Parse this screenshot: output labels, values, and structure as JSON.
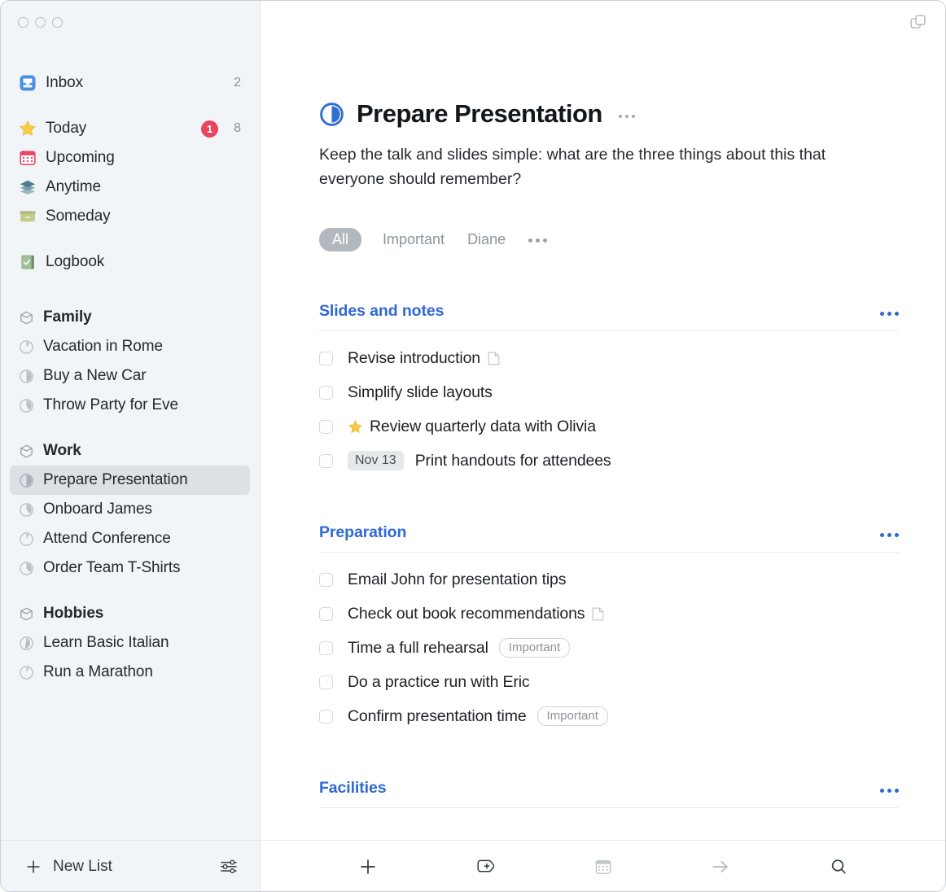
{
  "window": {
    "traffic_lights": [
      "close",
      "minimize",
      "zoom"
    ],
    "sidebar_toggle_icon": "split-view-icon",
    "accent_color": "#3069d3",
    "badge_color": "#e8455f"
  },
  "sidebar": {
    "top_items": [
      {
        "label": "Inbox",
        "icon": "inbox-icon",
        "count": "2",
        "badge": null,
        "bold": false
      },
      {
        "label": "Today",
        "icon": "star-icon",
        "count": "8",
        "badge": "1",
        "bold": false
      },
      {
        "label": "Upcoming",
        "icon": "calendar-icon",
        "count": "",
        "badge": null,
        "bold": false
      },
      {
        "label": "Anytime",
        "icon": "layers-icon",
        "count": "",
        "badge": null,
        "bold": false
      },
      {
        "label": "Someday",
        "icon": "box-icon",
        "count": "",
        "badge": null,
        "bold": false
      },
      {
        "label": "Logbook",
        "icon": "logbook-icon",
        "count": "",
        "badge": null,
        "bold": false
      }
    ],
    "areas": [
      {
        "label": "Family",
        "icon": "area-icon",
        "projects": [
          {
            "label": "Vacation in Rome",
            "icon": "project-progress-icon",
            "progress": 0.18
          },
          {
            "label": "Buy a New Car",
            "icon": "project-progress-icon",
            "progress": 0.5
          },
          {
            "label": "Throw Party for Eve",
            "icon": "project-progress-icon",
            "progress": 0.33
          }
        ]
      },
      {
        "label": "Work",
        "icon": "area-icon",
        "projects": [
          {
            "label": "Prepare Presentation",
            "icon": "project-progress-icon",
            "progress": 0.5,
            "selected": true
          },
          {
            "label": "Onboard James",
            "icon": "project-progress-icon",
            "progress": 0.3
          },
          {
            "label": "Attend Conference",
            "icon": "project-progress-icon",
            "progress": 0.15
          },
          {
            "label": "Order Team T-Shirts",
            "icon": "project-progress-icon",
            "progress": 0.28
          }
        ]
      },
      {
        "label": "Hobbies",
        "icon": "area-icon",
        "projects": [
          {
            "label": "Learn Basic Italian",
            "icon": "project-progress-icon",
            "progress": 0.55
          },
          {
            "label": "Run a Marathon",
            "icon": "project-progress-icon",
            "progress": 0.12
          }
        ]
      }
    ],
    "footer": {
      "new_list_label": "New List",
      "new_list_icon": "plus-icon",
      "settings_icon": "sliders-icon"
    }
  },
  "main": {
    "project": {
      "title": "Prepare Presentation",
      "icon": "project-progress-icon",
      "progress": 0.5,
      "more_icon": "ellipsis-icon",
      "notes": "Keep the talk and slides simple: what are the three things about this that everyone should remember?"
    },
    "filters": {
      "items": [
        "All",
        "Important",
        "Diane"
      ],
      "active": "All",
      "more_icon": "ellipsis-icon"
    },
    "sections": [
      {
        "title": "Slides and notes",
        "more_icon": "ellipsis-icon",
        "todos": [
          {
            "title": "Revise introduction",
            "checked": false,
            "star": false,
            "note": true,
            "date": null,
            "tags": []
          },
          {
            "title": "Simplify slide layouts",
            "checked": false,
            "star": false,
            "note": false,
            "date": null,
            "tags": []
          },
          {
            "title": "Review quarterly data with Olivia",
            "checked": false,
            "star": true,
            "note": false,
            "date": null,
            "tags": []
          },
          {
            "title": "Print handouts for attendees",
            "checked": false,
            "star": false,
            "note": false,
            "date": "Nov 13",
            "tags": []
          }
        ]
      },
      {
        "title": "Preparation",
        "more_icon": "ellipsis-icon",
        "todos": [
          {
            "title": "Email John for presentation tips",
            "checked": false,
            "star": false,
            "note": false,
            "date": null,
            "tags": []
          },
          {
            "title": "Check out book recommendations",
            "checked": false,
            "star": false,
            "note": true,
            "date": null,
            "tags": []
          },
          {
            "title": "Time a full rehearsal",
            "checked": false,
            "star": false,
            "note": false,
            "date": null,
            "tags": [
              "Important"
            ]
          },
          {
            "title": "Do a practice run with Eric",
            "checked": false,
            "star": false,
            "note": false,
            "date": null,
            "tags": []
          },
          {
            "title": "Confirm presentation time",
            "checked": false,
            "star": false,
            "note": false,
            "date": null,
            "tags": [
              "Important"
            ]
          }
        ]
      },
      {
        "title": "Facilities",
        "more_icon": "ellipsis-icon",
        "todos": []
      }
    ],
    "toolbar": [
      {
        "name": "new-todo-button",
        "icon": "plus-icon"
      },
      {
        "name": "new-heading-button",
        "icon": "plus-hexagon-icon"
      },
      {
        "name": "when-button",
        "icon": "calendar-icon"
      },
      {
        "name": "move-button",
        "icon": "arrow-right-icon"
      },
      {
        "name": "search-button",
        "icon": "search-icon"
      }
    ]
  }
}
